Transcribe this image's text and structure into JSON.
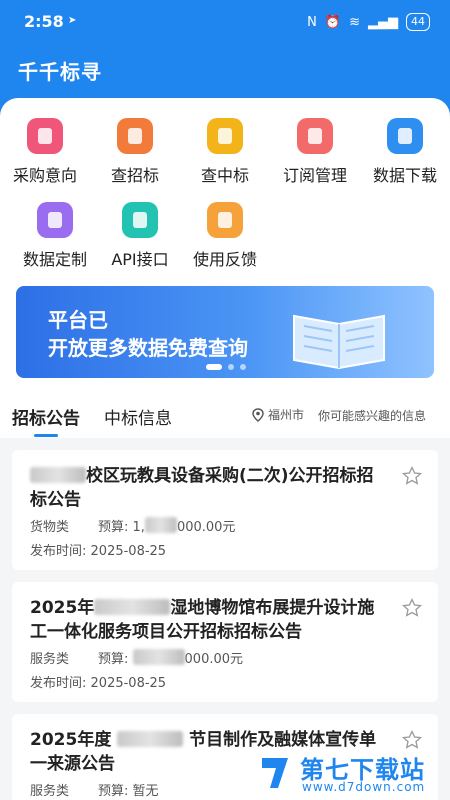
{
  "status": {
    "time": "2:58",
    "battery": "44"
  },
  "app": {
    "title": "千千标寻"
  },
  "grid": [
    {
      "label": "采购意向",
      "icon": "compass-icon",
      "color": "#f0567a"
    },
    {
      "label": "查招标",
      "icon": "document-icon",
      "color": "#f27a3a"
    },
    {
      "label": "查中标",
      "icon": "target-icon",
      "color": "#f2b418"
    },
    {
      "label": "订阅管理",
      "icon": "subscription-icon",
      "color": "#f36a6a"
    },
    {
      "label": "数据下载",
      "icon": "download-icon",
      "color": "#2f8ff0"
    },
    {
      "label": "数据定制",
      "icon": "customize-icon",
      "color": "#9a6cf0"
    },
    {
      "label": "API接口",
      "icon": "api-icon",
      "color": "#22c3b3"
    },
    {
      "label": "使用反馈",
      "icon": "feedback-icon",
      "color": "#f6a23a"
    }
  ],
  "banner": {
    "line1": "平台已",
    "line2": "开放更多数据免费查询"
  },
  "tabs": {
    "bidding": "招标公告",
    "winning": "中标信息"
  },
  "filter": {
    "city": "福州市",
    "interest": "你可能感兴趣的信息"
  },
  "items": [
    {
      "title": "校区玩教具设备采购(二次)公开招标招标公告",
      "category": "货物类",
      "budget_label": "预算:",
      "budget_value": "000.00元",
      "budget_prefix": "1,",
      "date_label": "发布时间:",
      "date": "2025-08-25"
    },
    {
      "title_a": "2025年",
      "title_b": "湿地博物馆布展提升设计施工一体化服务项目公开招标招标公告",
      "category": "服务类",
      "budget_label": "预算:",
      "budget_value": "000.00元",
      "date_label": "发布时间:",
      "date": "2025-08-25"
    },
    {
      "title_a": "2025年度",
      "title_b": "节目制作及融媒体宣传单一来源公告",
      "category": "服务类",
      "budget_label": "预算:",
      "budget_value": "暂无"
    }
  ],
  "watermark": {
    "name": "第七下载站",
    "url": "www.d7down.com"
  }
}
